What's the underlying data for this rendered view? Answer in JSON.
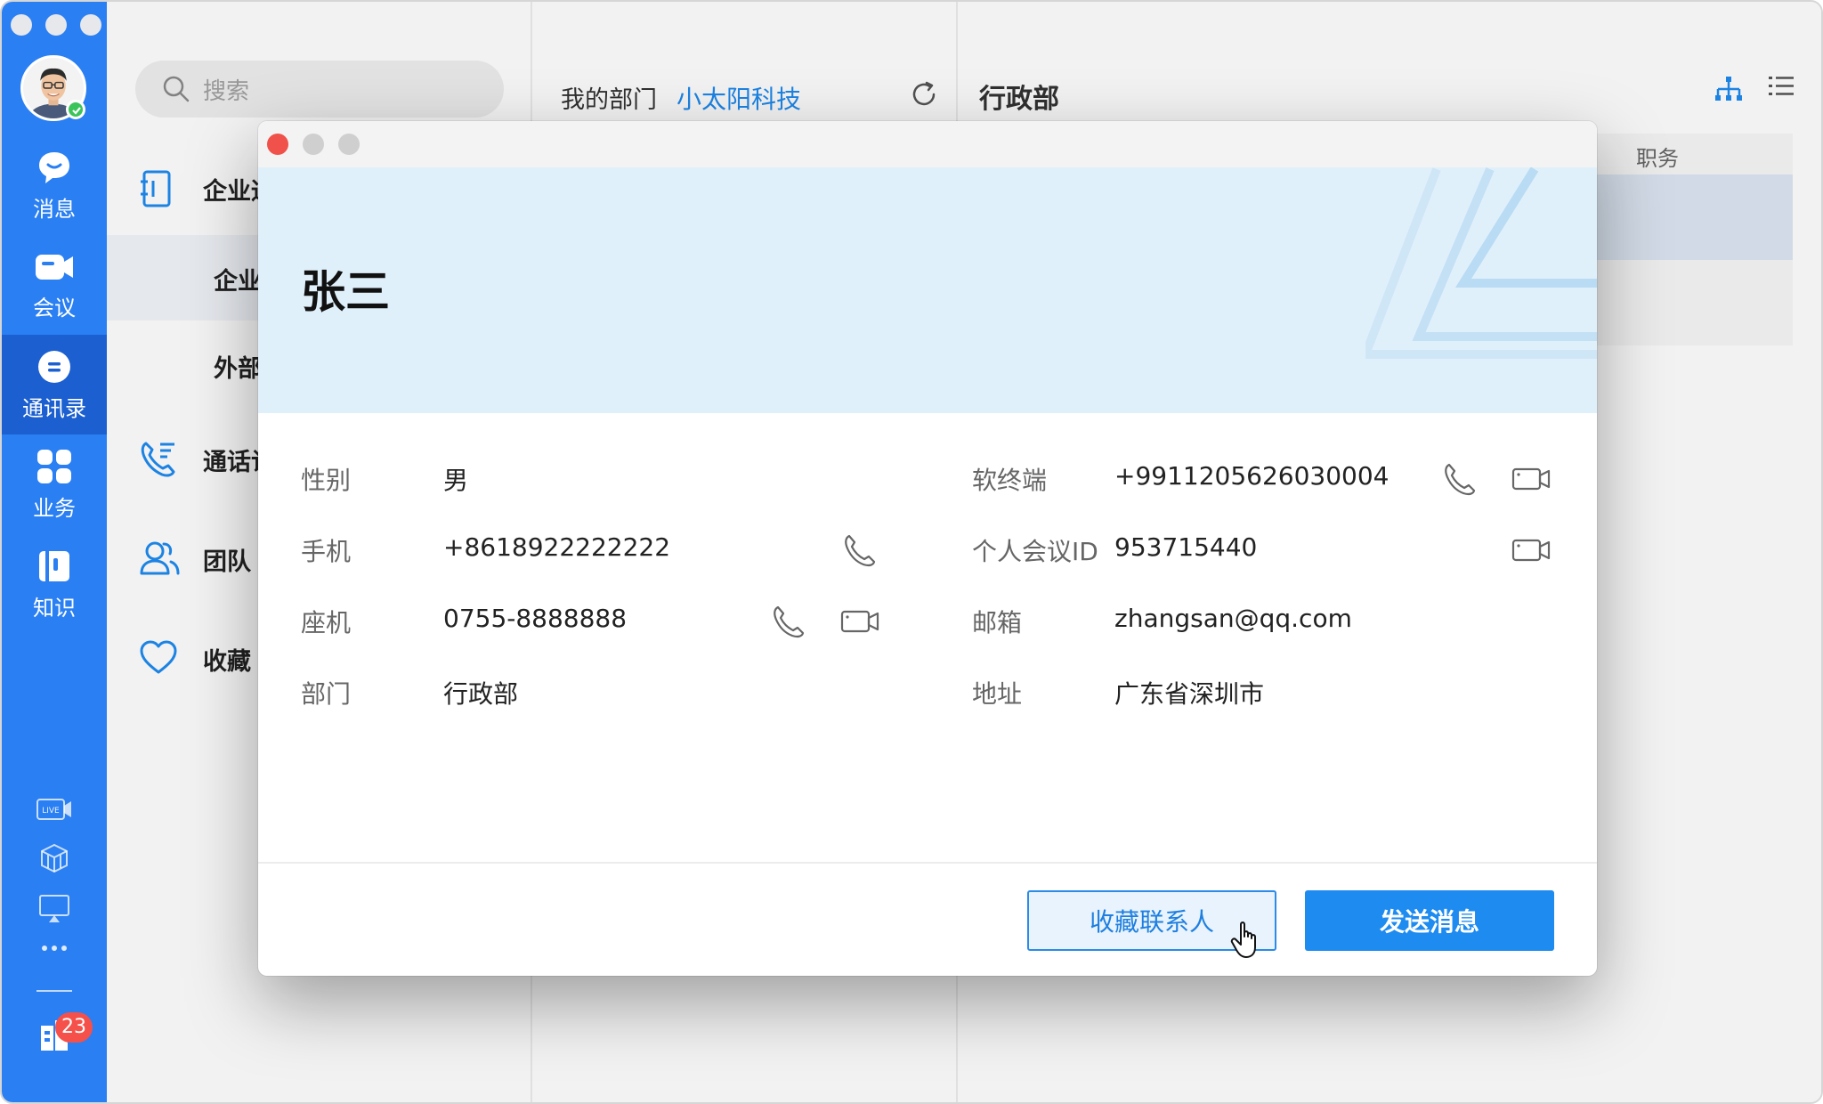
{
  "rail": {
    "items": [
      {
        "label": "消息"
      },
      {
        "label": "会议"
      },
      {
        "label": "通讯录"
      },
      {
        "label": "业务"
      },
      {
        "label": "知识"
      }
    ],
    "live_label": "LIVE",
    "badge_count": "23"
  },
  "panel2": {
    "search_placeholder": "搜索",
    "nav": [
      {
        "label": "企业通讯录"
      },
      {
        "label": "通话记录"
      },
      {
        "label": "团队"
      },
      {
        "label": "收藏"
      }
    ],
    "sub": [
      {
        "label": "企业成员"
      },
      {
        "label": "外部联系人"
      }
    ]
  },
  "panel3": {
    "my_dept_label": "我的部门",
    "company_name": "小太阳科技"
  },
  "panel4": {
    "title": "行政部",
    "column_position": "职务"
  },
  "modal": {
    "name": "张三",
    "left_fields": [
      {
        "label": "性别",
        "value": "男"
      },
      {
        "label": "手机",
        "value": "+8618922222222"
      },
      {
        "label": "座机",
        "value": "0755-8888888"
      },
      {
        "label": "部门",
        "value": "行政部"
      }
    ],
    "right_fields": [
      {
        "label": "软终端",
        "value": "+9911205626030004"
      },
      {
        "label": "个人会议ID",
        "value": "953715440"
      },
      {
        "label": "邮箱",
        "value": "zhangsan@qq.com"
      },
      {
        "label": "地址",
        "value": "广东省深圳市"
      }
    ],
    "fav_button": "收藏联系人",
    "send_button": "发送消息"
  },
  "colors": {
    "rail": "#2a7ff3",
    "rail_active": "#1b5fd0",
    "accent": "#1e8bf0",
    "hero_bg": "#e0f0fb",
    "close_red": "#f0514a",
    "badge_red": "#f5514a"
  }
}
